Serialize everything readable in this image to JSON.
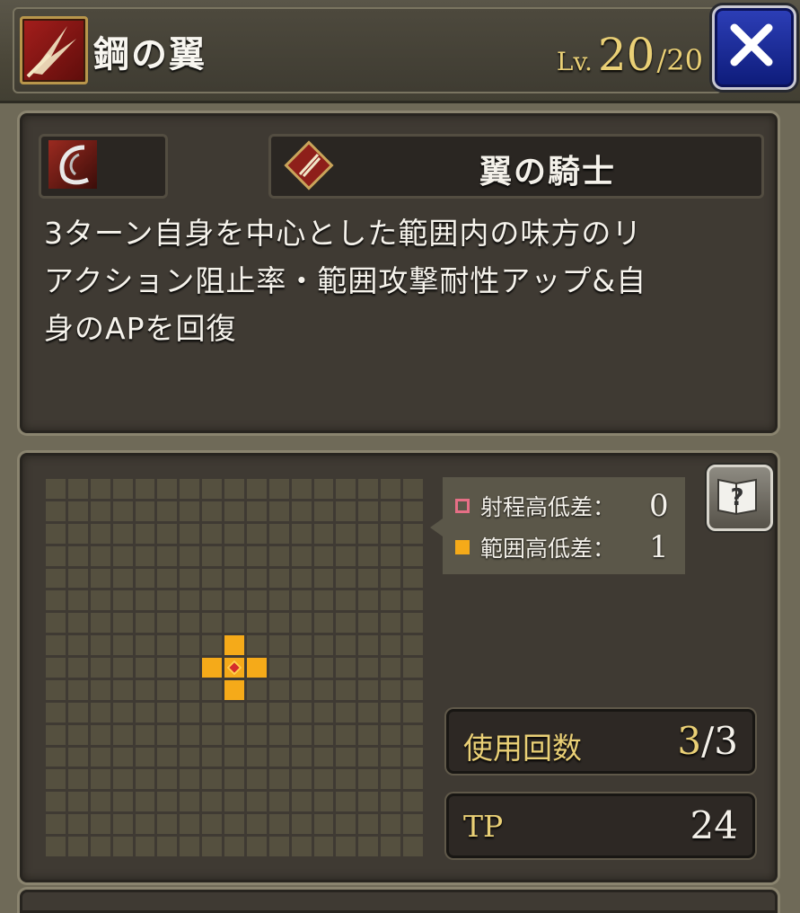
{
  "header": {
    "skill_name": "鋼の翼",
    "level_prefix": "Lv.",
    "level_current": "20",
    "level_max": "/20",
    "skill_type_icon": "physical-slash-icon",
    "close_icon": "close-x-icon"
  },
  "details": {
    "element_icon": "wind-element-icon",
    "job_icon": "wing-knight-job-icon",
    "job_name": "翼の騎士",
    "description_lines": [
      "3ターン自身を中心とした範囲内の味方のリ",
      "アクション阻止率・範囲攻撃耐性アップ&自",
      "身のAPを回復"
    ]
  },
  "range": {
    "grid_size": 17,
    "area_cells": [
      [
        7,
        8
      ],
      [
        8,
        7
      ],
      [
        8,
        9
      ],
      [
        9,
        8
      ]
    ],
    "center_cell": [
      8,
      8
    ],
    "legend": {
      "range_label": "射程高低差：",
      "range_value": "0",
      "area_label": "範囲高低差：",
      "area_value": "1"
    },
    "help_icon": "help-book-icon"
  },
  "stats": {
    "uses_label": "使用回数",
    "uses_current": "3",
    "uses_max": "/3",
    "tp_label": "TP",
    "tp_value": "24"
  },
  "colors": {
    "area": "#f5aa19",
    "range_marker": "#e66f86",
    "gold_text": "#ead076",
    "close_button": "#1a2a9c"
  }
}
